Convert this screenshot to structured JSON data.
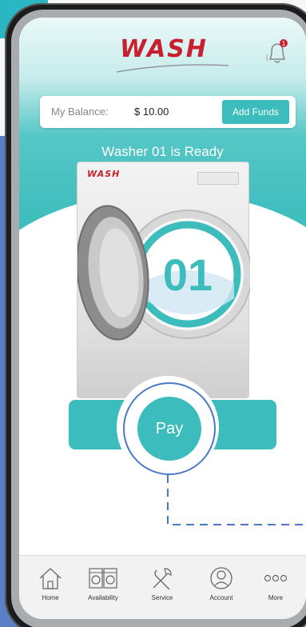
{
  "header": {
    "logo_text": "WASH",
    "notification_badge": "1"
  },
  "balance": {
    "label": "My Balance:",
    "value": "$ 10.00",
    "add_funds_label": "Add Funds"
  },
  "status": {
    "title": "Washer 01 is Ready",
    "machine_brand": "WASH",
    "machine_number": "01"
  },
  "actions": {
    "pay_label": "Pay"
  },
  "tabbar": {
    "items": [
      {
        "label": "Home",
        "icon": "home-icon"
      },
      {
        "label": "Availability",
        "icon": "washer-icon"
      },
      {
        "label": "Service",
        "icon": "tools-icon"
      },
      {
        "label": "Account",
        "icon": "user-icon"
      },
      {
        "label": "More",
        "icon": "more-icon"
      }
    ]
  },
  "colors": {
    "accent": "#3cbcbc",
    "brand": "#c8202e",
    "highlight": "#4a78c8"
  }
}
